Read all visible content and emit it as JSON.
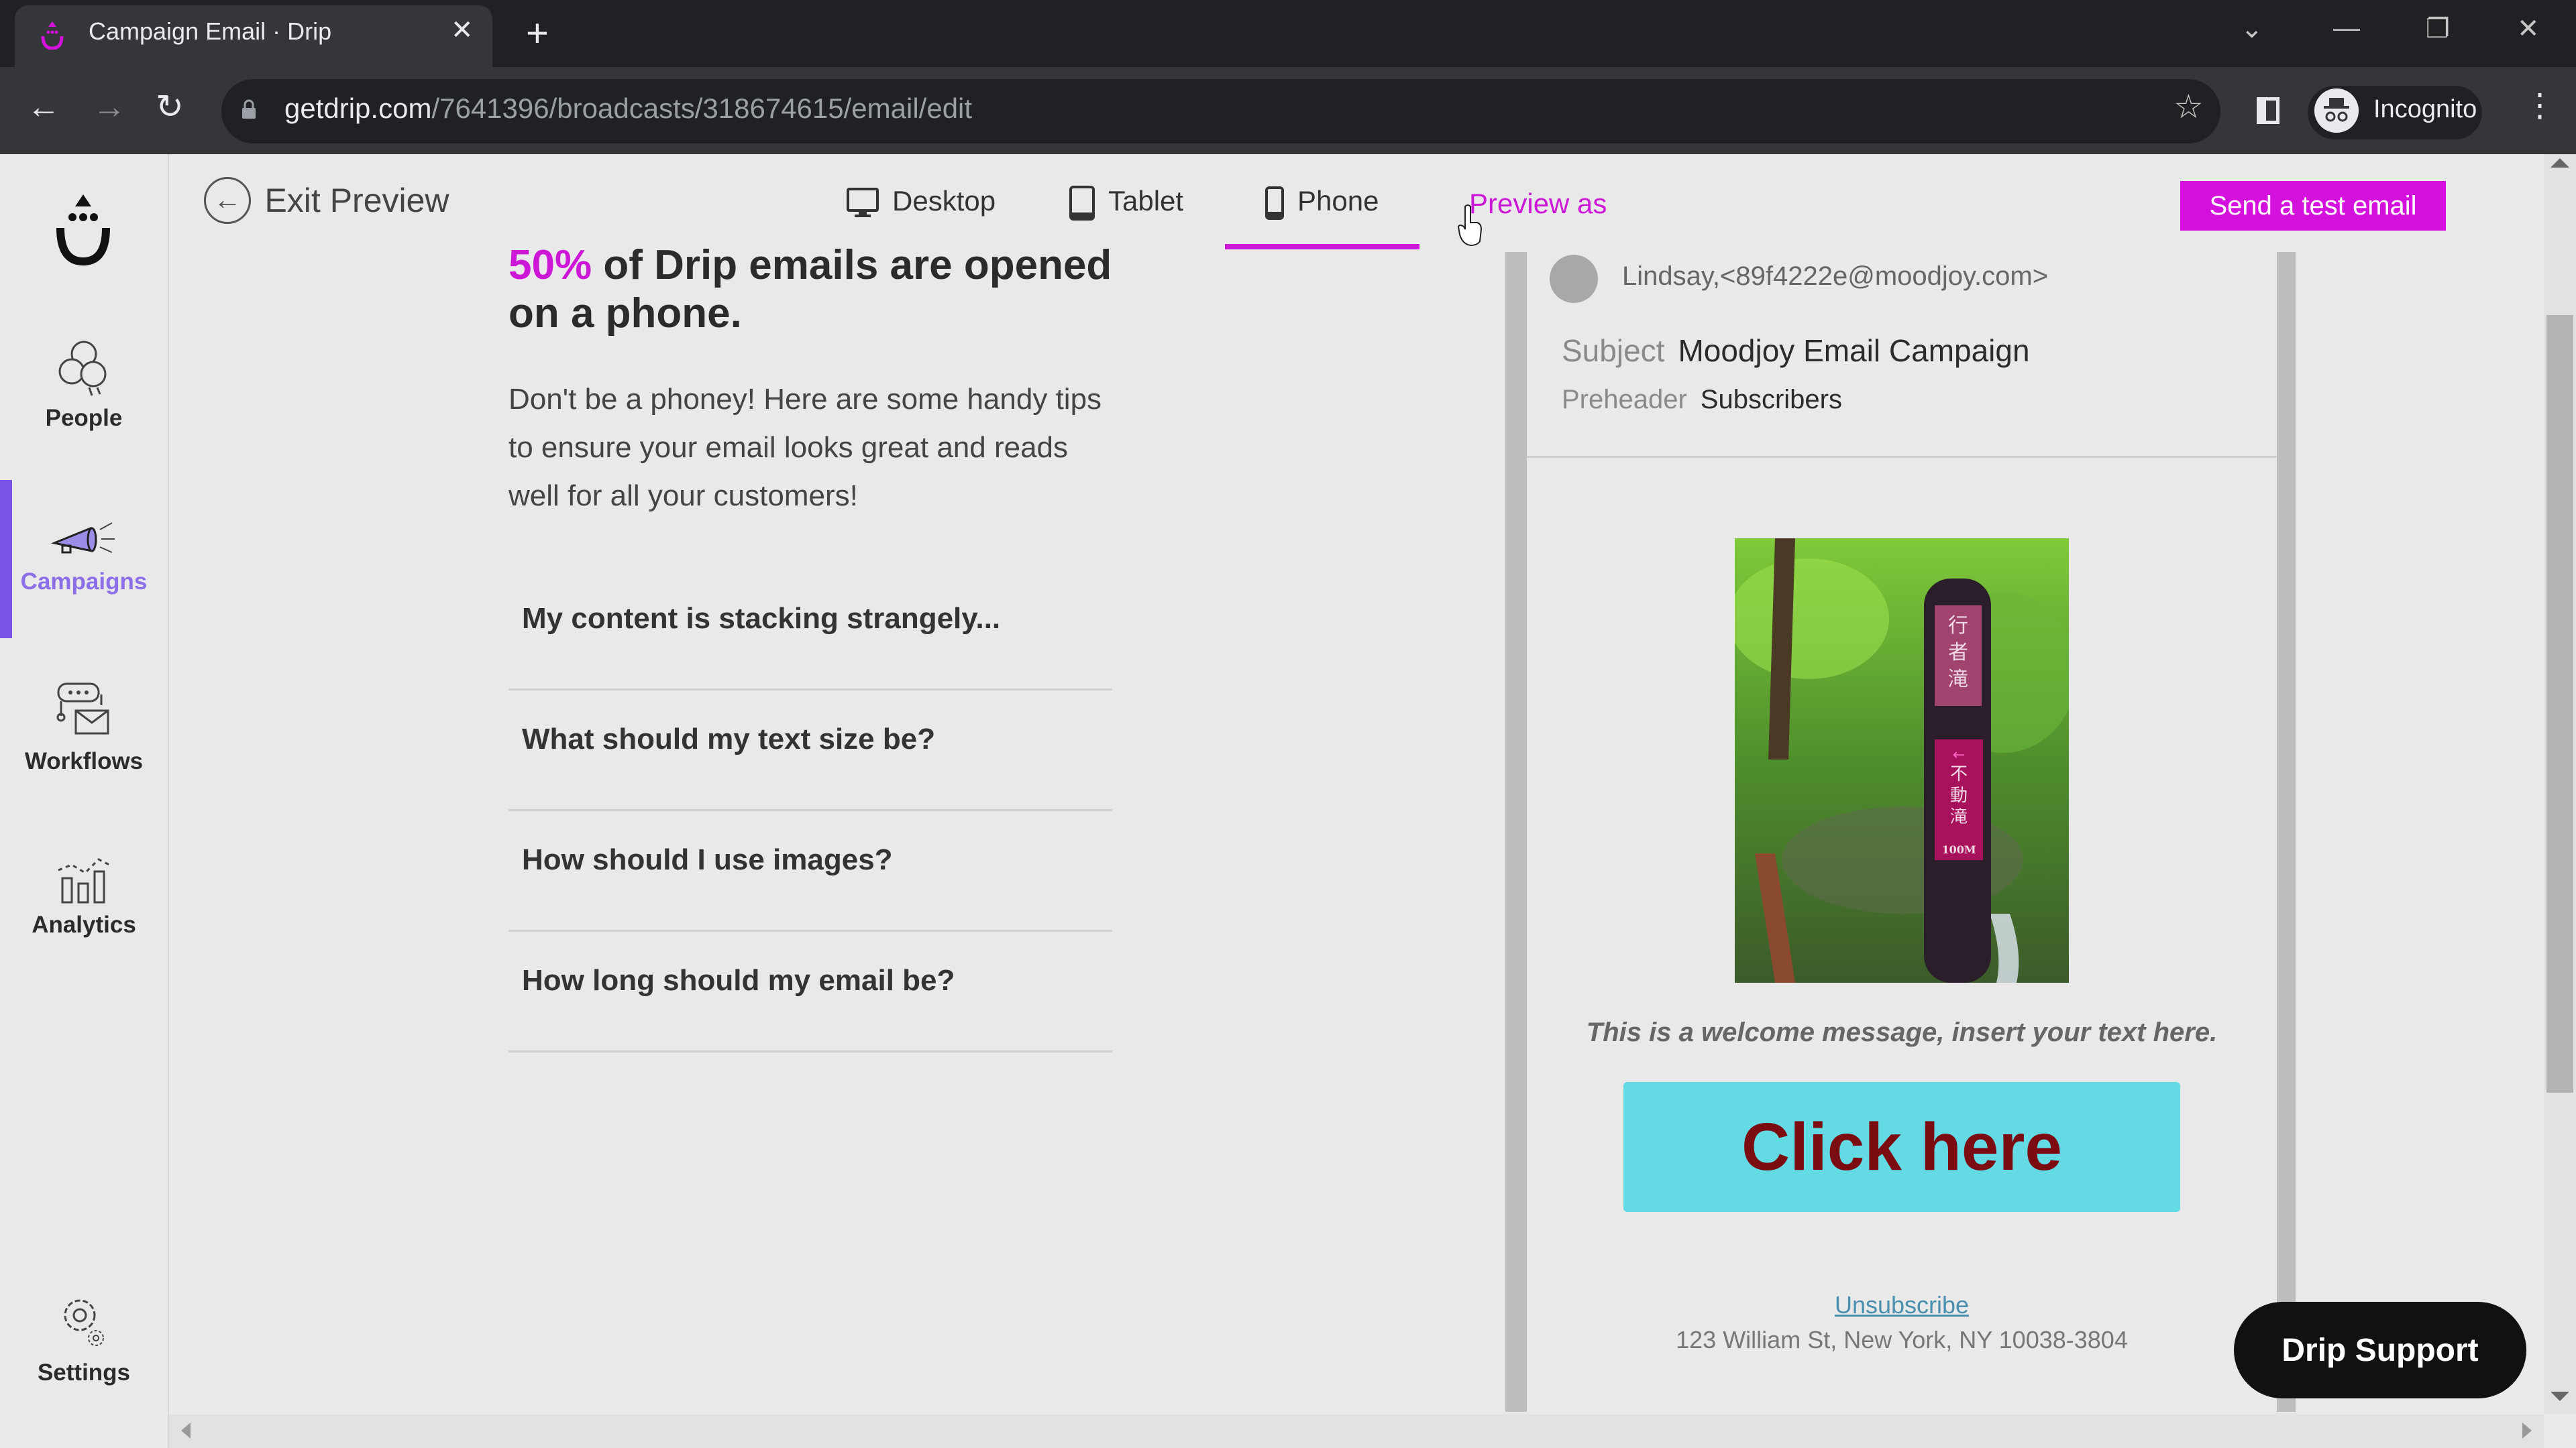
{
  "browser": {
    "tab_title": "Campaign Email · Drip",
    "url_host": "getdrip.com",
    "url_path": "/7641396/broadcasts/318674615/email/edit",
    "profile_label": "Incognito",
    "icons": {
      "tab_favicon": "drip-logo-icon",
      "tab_close": "close-icon",
      "new_tab": "plus-icon",
      "tab_search": "chevron-down-icon",
      "minimize": "minimize-icon",
      "restore": "restore-icon",
      "close_window": "close-icon",
      "back": "arrow-left-icon",
      "forward": "arrow-right-icon",
      "reload": "reload-icon",
      "lock": "lock-icon",
      "bookmark": "star-icon",
      "side_panel": "side-panel-icon",
      "incognito": "incognito-icon",
      "menu": "more-vert-icon"
    }
  },
  "sidebar": {
    "items": [
      {
        "label": "People",
        "icon": "people-icon",
        "active": false
      },
      {
        "label": "Campaigns",
        "icon": "megaphone-icon",
        "active": true
      },
      {
        "label": "Workflows",
        "icon": "workflow-icon",
        "active": false
      },
      {
        "label": "Analytics",
        "icon": "analytics-icon",
        "active": false
      },
      {
        "label": "Settings",
        "icon": "gear-icon",
        "active": false
      }
    ],
    "active_color": "#7a54e6"
  },
  "preview_bar": {
    "exit_label": "Exit Preview",
    "devices": [
      {
        "label": "Desktop",
        "icon": "desktop-icon",
        "selected": false
      },
      {
        "label": "Tablet",
        "icon": "tablet-icon",
        "selected": false
      },
      {
        "label": "Phone",
        "icon": "phone-icon",
        "selected": true
      }
    ],
    "preview_as_label": "Preview as",
    "send_test_label": "Send a test email",
    "accent_color": "#d411dc"
  },
  "tips": {
    "headline_pct": "50%",
    "headline_rest": " of Drip emails are opened on a phone.",
    "intro": "Don't be a phoney! Here are some handy tips to ensure your email looks great and reads well for all your customers!",
    "faqs": [
      "My content is stacking strangely...",
      "What should my text size be?",
      "How should I use images?",
      "How long should my email be?"
    ]
  },
  "email_preview": {
    "from": "Lindsay,<89f4222e@moodjoy.com>",
    "subject_label": "Subject",
    "subject": "Moodjoy Email Campaign",
    "preheader_label": "Preheader",
    "preheader": "Subscribers",
    "image_alt": "Forest trail sign post",
    "sign_top": "行者滝",
    "sign_bottom": "不動滝",
    "sign_distance": "100M",
    "welcome_text": "This is a welcome message, insert your text here.",
    "cta_label": "Click here",
    "cta_color": "#64dbe4",
    "cta_text_color": "#7a0c12",
    "unsubscribe_label": "Unsubscribe",
    "address": "123 William St, New York, NY 10038-3804"
  },
  "support": {
    "label": "Drip Support"
  }
}
